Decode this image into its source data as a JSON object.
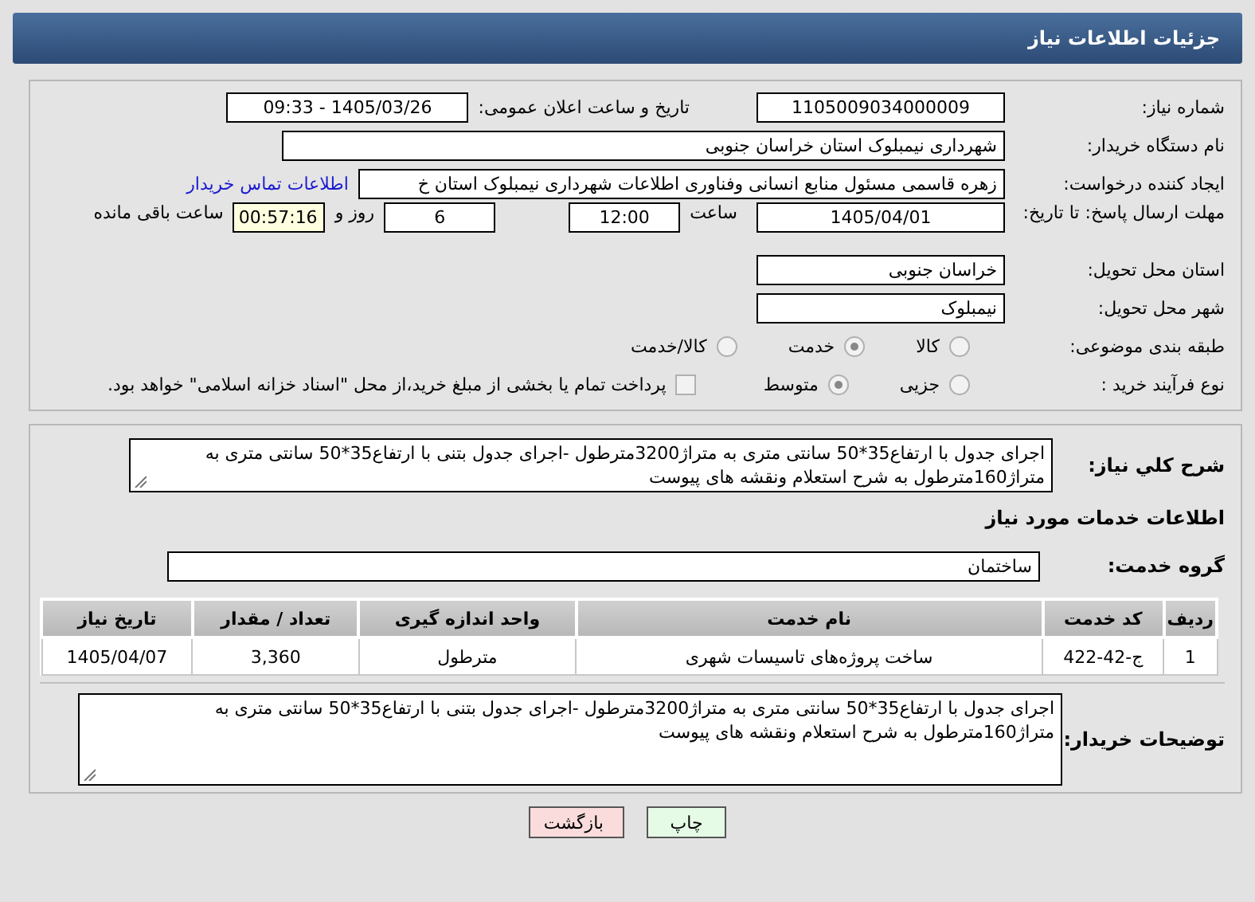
{
  "header": {
    "title": "جزئیات اطلاعات نیاز"
  },
  "need_number": {
    "label": "شماره نیاز:",
    "value": "1105009034000009"
  },
  "announce_datetime": {
    "label": "تاریخ و ساعت اعلان عمومی:",
    "value": "1405/03/26 - 09:33"
  },
  "buyer_org": {
    "label": "نام دستگاه خریدار:",
    "value": "شهرداری نیمبلوک استان خراسان جنوبی"
  },
  "requester": {
    "label": "ایجاد کننده درخواست:",
    "value": "زهره قاسمی مسئول منابع انسانی وفناوری اطلاعات شهرداری نیمبلوک استان خ",
    "link": "اطلاعات تماس خریدار"
  },
  "deadline": {
    "label": "مهلت ارسال پاسخ: تا تاریخ:",
    "date": "1405/04/01",
    "time_label": "ساعت",
    "time": "12:00",
    "days": "6",
    "days_label": "روز و",
    "remaining": "00:57:16",
    "remaining_label": "ساعت باقی مانده"
  },
  "delivery_province": {
    "label": "استان محل تحویل:",
    "value": "خراسان جنوبی"
  },
  "delivery_city": {
    "label": "شهر محل تحویل:",
    "value": "نیمبلوک"
  },
  "category": {
    "label": "طبقه بندی موضوعی:",
    "options": [
      {
        "label": "کالا",
        "selected": false
      },
      {
        "label": "خدمت",
        "selected": true
      },
      {
        "label": "کالا/خدمت",
        "selected": false
      }
    ]
  },
  "purchase_process": {
    "label": "نوع فرآیند خرید :",
    "options": [
      {
        "label": "جزیی",
        "selected": false
      },
      {
        "label": "متوسط",
        "selected": true
      }
    ],
    "payment_note": {
      "label": "پرداخت تمام یا بخشی از مبلغ خرید،از محل \"اسناد خزانه اسلامی\" خواهد بود.",
      "checked": false
    }
  },
  "description": {
    "label": "شرح کلي نياز:",
    "text": "اجرای جدول با ارتفاع35*50 سانتی متری  به متراژ3200مترطول -اجرای جدول بتنی با ارتفاع35*50 سانتی متری به متراژ160مترطول به شرح استعلام ونقشه های پیوست"
  },
  "services_title": "اطلاعات خدمات مورد نياز",
  "service_group": {
    "label": "گروه خدمت:",
    "value": "ساختمان"
  },
  "table": {
    "columns": [
      "ردیف",
      "کد خدمت",
      "نام خدمت",
      "واحد اندازه گیری",
      "تعداد / مقدار",
      "تاریخ نیاز"
    ],
    "rows": [
      [
        "1",
        "ج-42-422",
        "ساخت پروژه‌های تاسیسات شهری",
        "مترطول",
        "3,360",
        "1405/04/07"
      ]
    ]
  },
  "buyer_notes": {
    "label": "توضیحات خریدار:",
    "text": "اجرای جدول با ارتفاع35*50 سانتی متری  به متراژ3200مترطول -اجرای جدول بتنی با ارتفاع35*50 سانتی متری به متراژ160مترطول به شرح استعلام ونقشه های پیوست"
  },
  "buttons": [
    {
      "label": "چاپ",
      "kind": "print"
    },
    {
      "label": "بازگشت",
      "kind": "back"
    }
  ]
}
